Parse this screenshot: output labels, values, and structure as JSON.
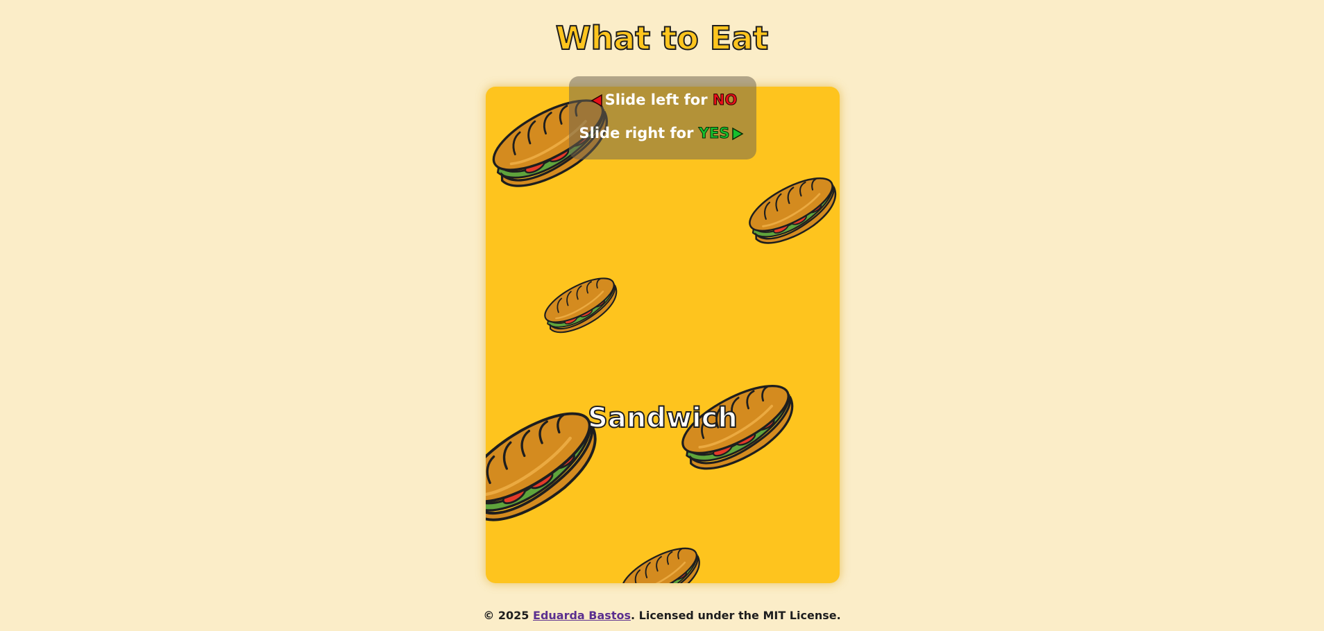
{
  "header": {
    "title": "What to Eat"
  },
  "hints": {
    "left_prefix": "Slide left for",
    "left_answer": "NO",
    "right_prefix": "Slide right for",
    "right_answer": "YES",
    "left_arrow_icon": "triangle-left-icon",
    "right_arrow_icon": "triangle-right-icon"
  },
  "card": {
    "food_name": "Sandwich",
    "background_color": "#FEC41E",
    "pattern_icon": "sandwich-icon"
  },
  "footer": {
    "copyright": "© 2025",
    "author_link": "Eduarda Bastos",
    "license_text": ". Licensed under the MIT License."
  },
  "colors": {
    "page_background": "#FBEDC8",
    "title_fill": "#FFC51E",
    "no_color": "#E8101A",
    "yes_color": "#17C02E",
    "link_color": "#5B2F8F"
  }
}
